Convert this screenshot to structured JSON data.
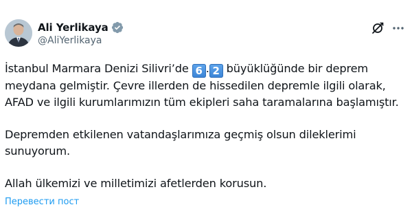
{
  "author": {
    "display_name": "Ali Yerlikaya",
    "handle": "@AliYerlikaya"
  },
  "icons": {
    "verified": "verified-badge-icon",
    "grok": "grok-icon",
    "more": "more-icon"
  },
  "colors": {
    "link": "#1d9bf0",
    "secondary_text": "#536471",
    "verified_badge": "#829aab"
  },
  "tweet": {
    "line1_part1": "İstanbul Marmara Denizi Silivri’de ",
    "emoji_digit_1": "6",
    "emoji_dot": ".",
    "emoji_digit_2": "2",
    "line1_part2": " büyüklüğünde bir deprem meydana gelmiştir. Çevre illerden de hissedilen depremle ilgili olarak, AFAD ve ilgili kurumlarımızın tüm ekipleri saha taramalarına başlamıştır.",
    "paragraph2": "Depremden etkilenen vatandaşlarımıza geçmiş olsun dileklerimi sunuyorum.",
    "paragraph3": "Allah ülkemizi ve milletimizi afetlerden korusun."
  },
  "translate_label": "Перевести пост"
}
